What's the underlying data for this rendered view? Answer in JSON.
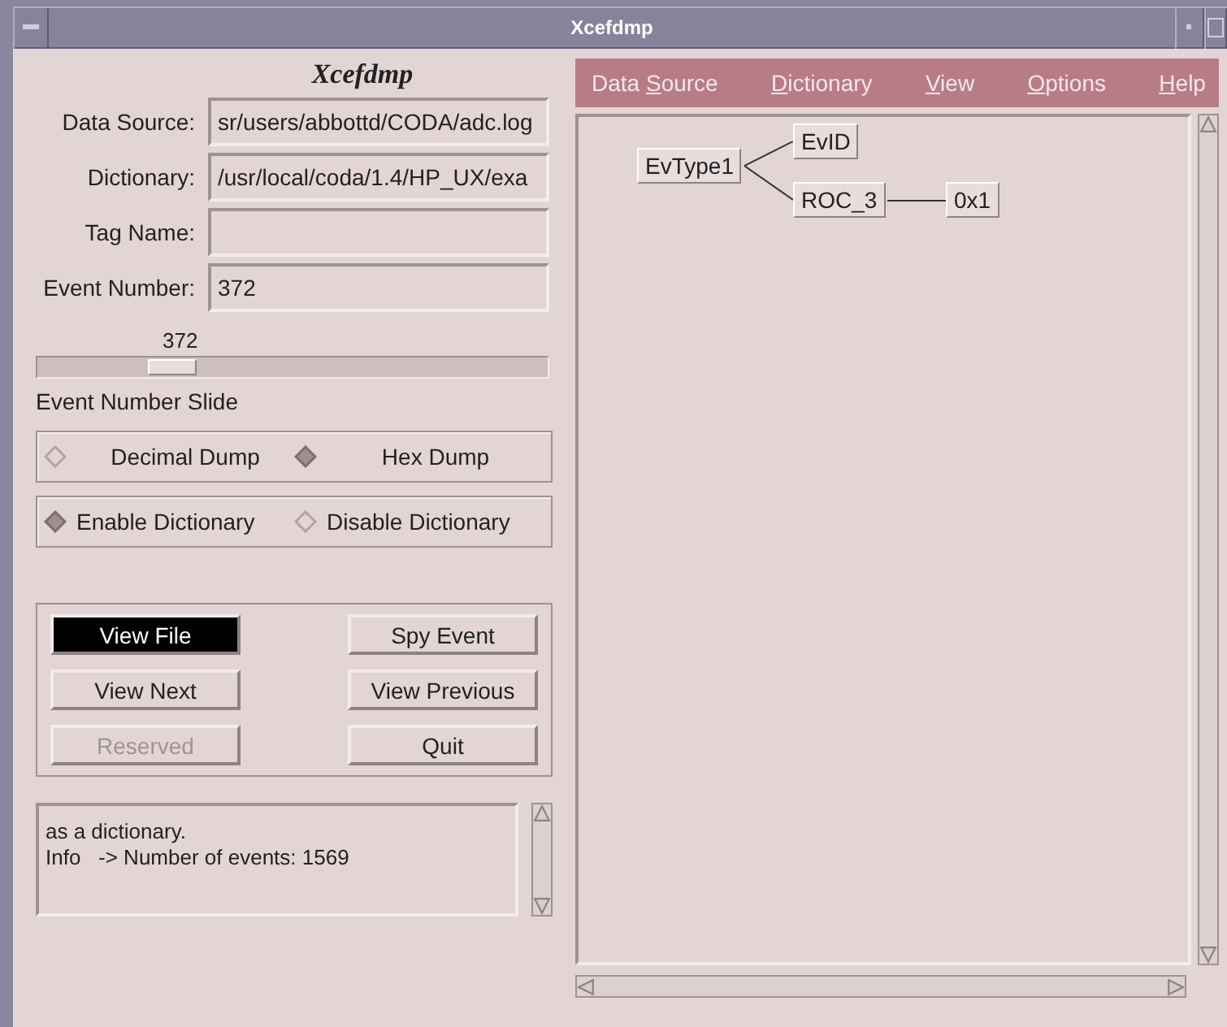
{
  "window": {
    "title": "Xcefdmp"
  },
  "panel_title": "Xcefdmp",
  "fields": [
    {
      "label": "Data Source:",
      "value": "sr/users/abbottd/CODA/adc.log"
    },
    {
      "label": "Dictionary:",
      "value": "/usr/local/coda/1.4/HP_UX/exa"
    },
    {
      "label": "Tag Name:"
    },
    {
      "label": "Event Number:",
      "value": "372"
    }
  ],
  "slider": {
    "reading": "372",
    "level": 0.24,
    "label": "Event Number Slide"
  },
  "radio_groups": [
    [
      {
        "label": "Decimal Dump",
        "selected": false
      },
      {
        "label": "Hex Dump",
        "selected": true
      }
    ],
    [
      {
        "label": "Enable Dictionary",
        "selected": true
      },
      {
        "label": "Disable Dictionary",
        "selected": false
      }
    ]
  ],
  "buttons": [
    {
      "label": "View File",
      "selected": true,
      "disabled": false
    },
    {
      "label": "Spy Event",
      "selected": false,
      "disabled": false
    },
    {
      "label": "View Next",
      "selected": false,
      "disabled": false
    },
    {
      "label": "View Previous",
      "selected": false,
      "disabled": false
    },
    {
      "label": "Reserved",
      "selected": false,
      "disabled": true
    },
    {
      "label": "Quit",
      "selected": false,
      "disabled": false
    }
  ],
  "log": [
    "as a dictionary.",
    "Info   -> Number of events: 1569"
  ],
  "menu": [
    {
      "before": "Data ",
      "mnemonic": "S",
      "after": "ource"
    },
    {
      "mnemonic": "D",
      "after": "ictionary"
    },
    {
      "mnemonic": "V",
      "after": "iew"
    },
    {
      "mnemonic": "O",
      "after": "ptions"
    },
    {
      "mnemonic": "H",
      "after": "elp"
    }
  ],
  "tree": {
    "label": "EvType1",
    "children": [
      {
        "label": "EvID"
      },
      {
        "label": "ROC_3",
        "children": [
          {
            "label": "0x1"
          }
        ]
      }
    ]
  }
}
